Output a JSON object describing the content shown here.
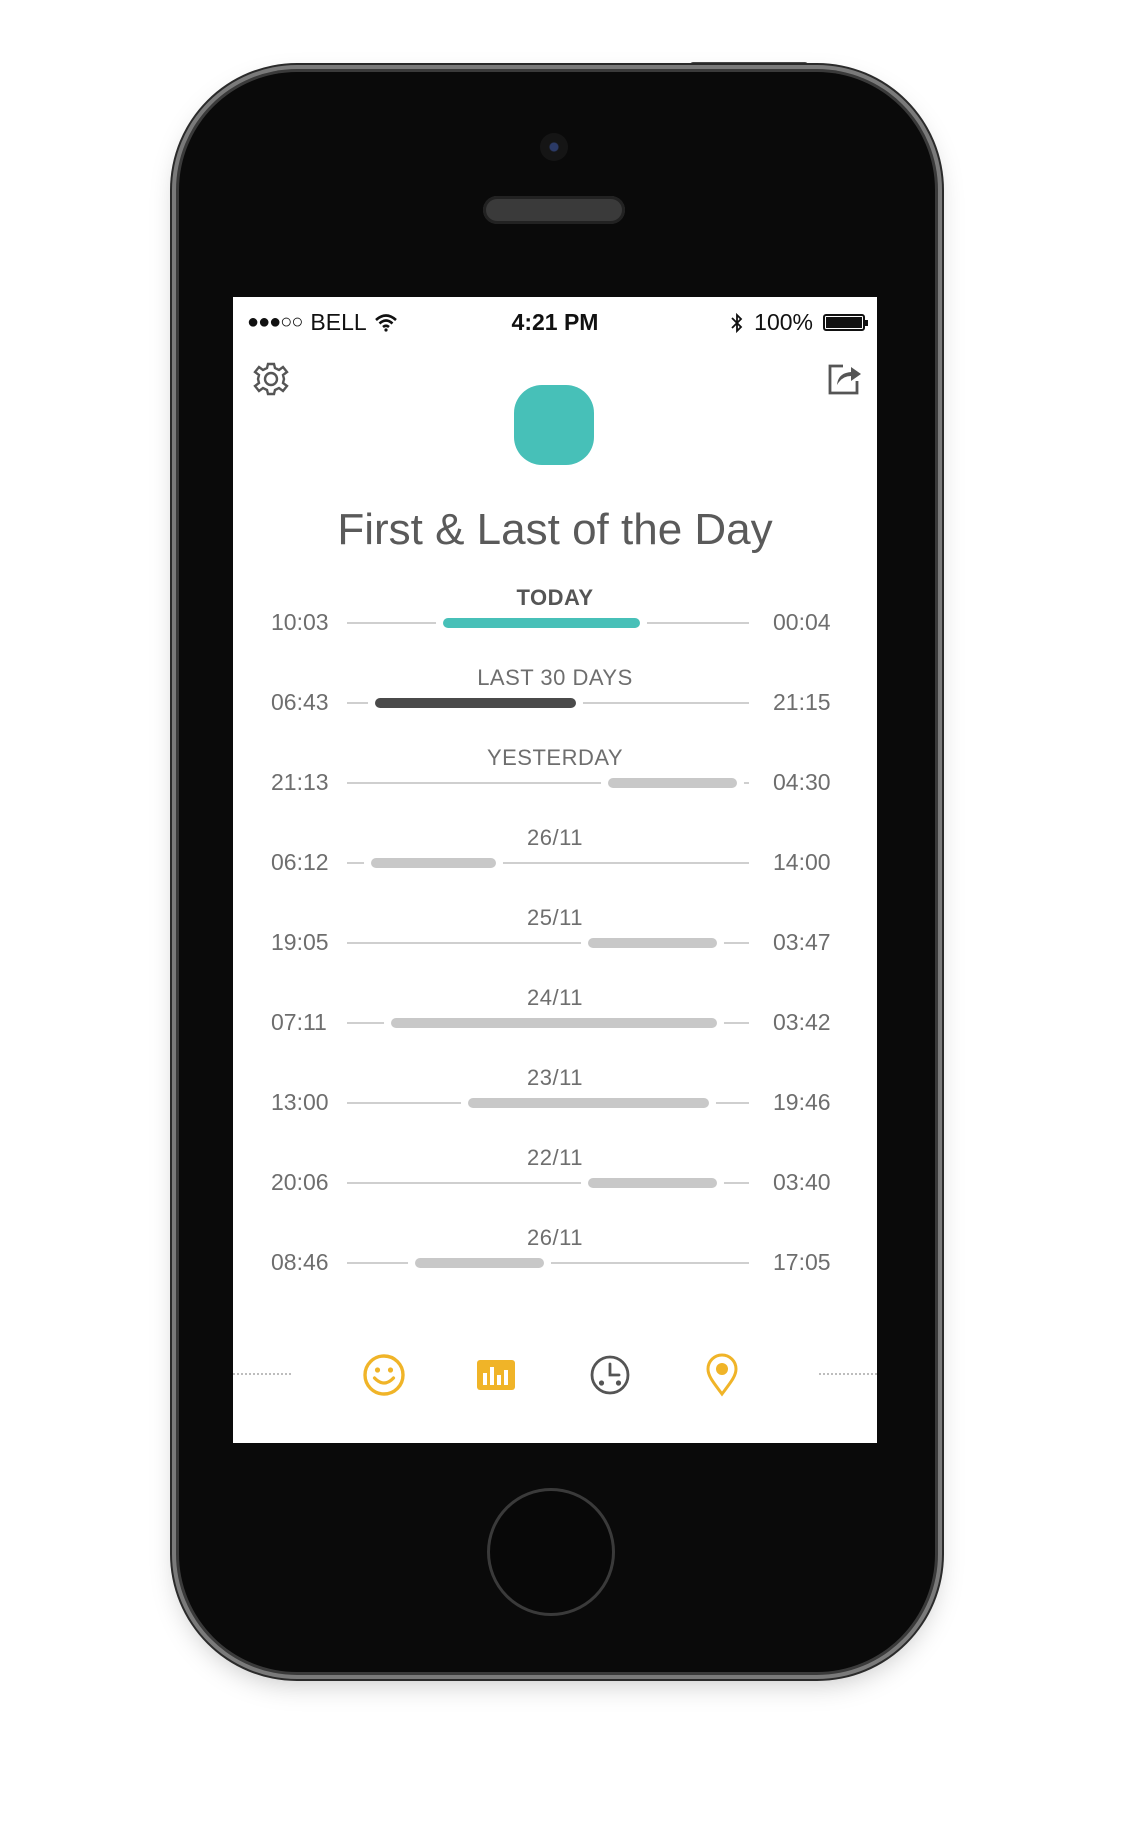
{
  "status_bar": {
    "signal": "●●●○○",
    "carrier": "BELL",
    "time": "4:21 PM",
    "battery": "100%",
    "battery_level": 1.0
  },
  "header": {
    "settings_icon": "gear-icon",
    "share_icon": "share-icon",
    "title": "First & Last of the Day"
  },
  "colors": {
    "accent": "#47c0b8",
    "dark_bar": "#4a4a4a",
    "light_bar": "#c8c8c8",
    "tab_icon": "#f0b428",
    "tab_icon_inactive": "#555555"
  },
  "rows": [
    {
      "label": "TODAY",
      "start": "10:03",
      "end": "00:04",
      "bar_from": 0.24,
      "bar_to": 0.73,
      "style": "accent"
    },
    {
      "label": "LAST 30 DAYS",
      "start": "06:43",
      "end": "21:15",
      "bar_from": 0.07,
      "bar_to": 0.57,
      "style": "dark"
    },
    {
      "label": "YESTERDAY",
      "start": "21:13",
      "end": "04:30",
      "bar_from": 0.65,
      "bar_to": 0.97,
      "style": "light"
    },
    {
      "label": "26/11",
      "start": "06:12",
      "end": "14:00",
      "bar_from": 0.06,
      "bar_to": 0.37,
      "style": "light"
    },
    {
      "label": "25/11",
      "start": "19:05",
      "end": "03:47",
      "bar_from": 0.6,
      "bar_to": 0.92,
      "style": "light"
    },
    {
      "label": "24/11",
      "start": "07:11",
      "end": "03:42",
      "bar_from": 0.11,
      "bar_to": 0.92,
      "style": "light"
    },
    {
      "label": "23/11",
      "start": "13:00",
      "end": "19:46",
      "bar_from": 0.3,
      "bar_to": 0.9,
      "style": "light"
    },
    {
      "label": "22/11",
      "start": "20:06",
      "end": "03:40",
      "bar_from": 0.6,
      "bar_to": 0.92,
      "style": "light"
    },
    {
      "label": "26/11",
      "start": "08:46",
      "end": "17:05",
      "bar_from": 0.17,
      "bar_to": 0.49,
      "style": "light"
    }
  ],
  "tabs": [
    {
      "icon": "smiley-icon",
      "name": "tab-mood"
    },
    {
      "icon": "bar-chart-icon",
      "name": "tab-stats"
    },
    {
      "icon": "clock-icon",
      "name": "tab-time"
    },
    {
      "icon": "location-pin-icon",
      "name": "tab-location"
    }
  ]
}
